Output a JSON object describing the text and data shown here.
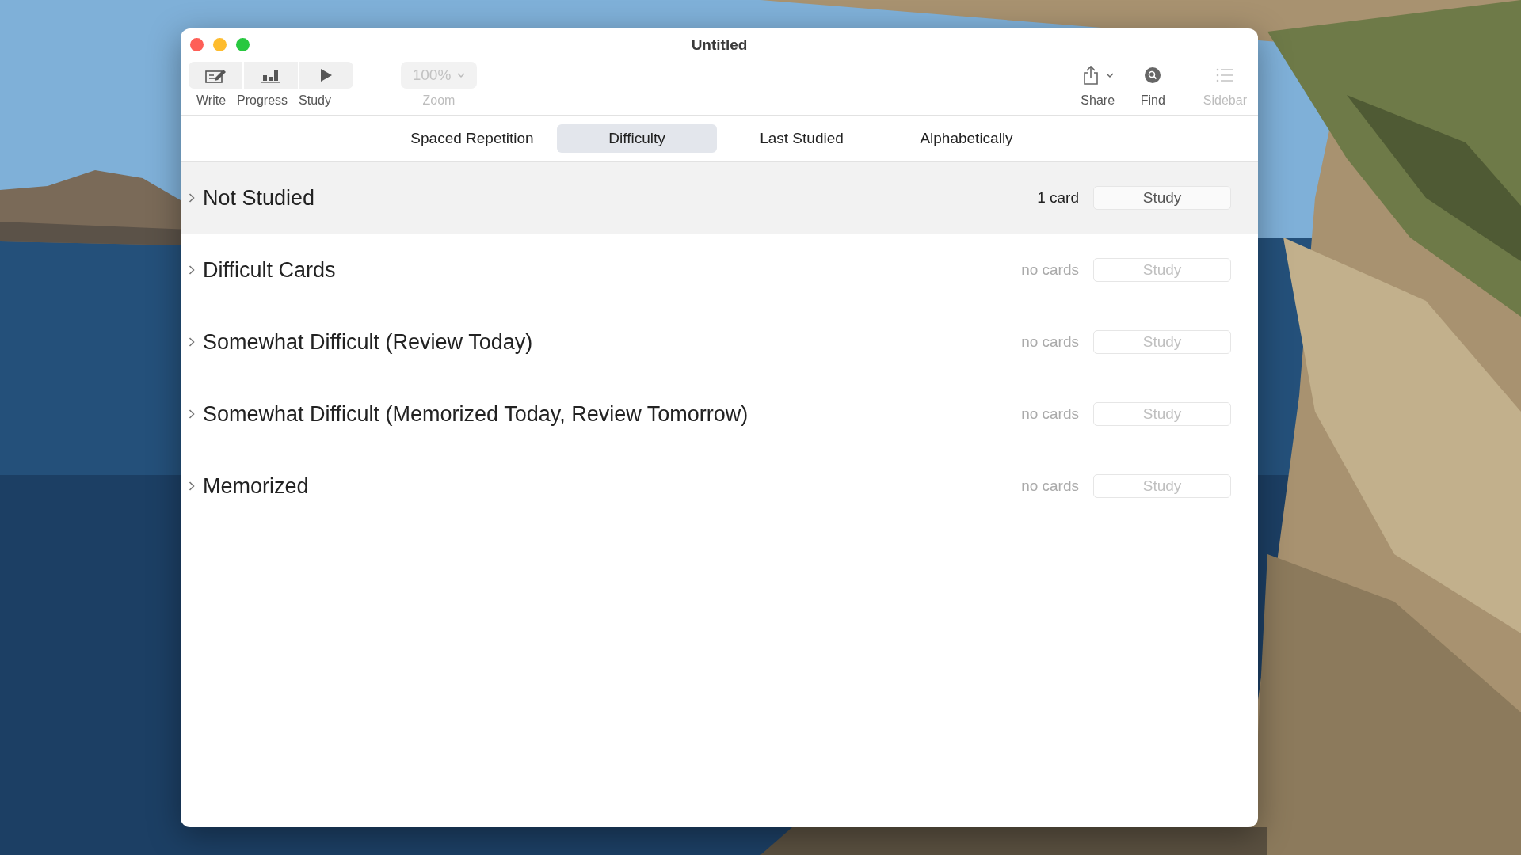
{
  "window": {
    "title": "Untitled"
  },
  "toolbar": {
    "segments": [
      {
        "label": "Write"
      },
      {
        "label": "Progress"
      },
      {
        "label": "Study"
      }
    ],
    "zoom": {
      "value": "100%",
      "label": "Zoom",
      "disabled": true
    },
    "share": {
      "label": "Share",
      "disabled": false
    },
    "find": {
      "label": "Find",
      "disabled": false
    },
    "sidebar": {
      "label": "Sidebar",
      "disabled": true
    }
  },
  "tabs": [
    {
      "label": "Spaced Repetition",
      "selected": false
    },
    {
      "label": "Difficulty",
      "selected": true
    },
    {
      "label": "Last Studied",
      "selected": false
    },
    {
      "label": "Alphabetically",
      "selected": false
    }
  ],
  "sections": [
    {
      "title": "Not Studied",
      "count": "1 card",
      "button": "Study",
      "selected": true,
      "disabled": false
    },
    {
      "title": "Difficult Cards",
      "count": "no cards",
      "button": "Study",
      "selected": false,
      "disabled": true
    },
    {
      "title": "Somewhat Difficult (Review Today)",
      "count": "no cards",
      "button": "Study",
      "selected": false,
      "disabled": true
    },
    {
      "title": "Somewhat Difficult (Memorized Today, Review Tomorrow)",
      "count": "no cards",
      "button": "Study",
      "selected": false,
      "disabled": true
    },
    {
      "title": "Memorized",
      "count": "no cards",
      "button": "Study",
      "selected": false,
      "disabled": true
    }
  ]
}
